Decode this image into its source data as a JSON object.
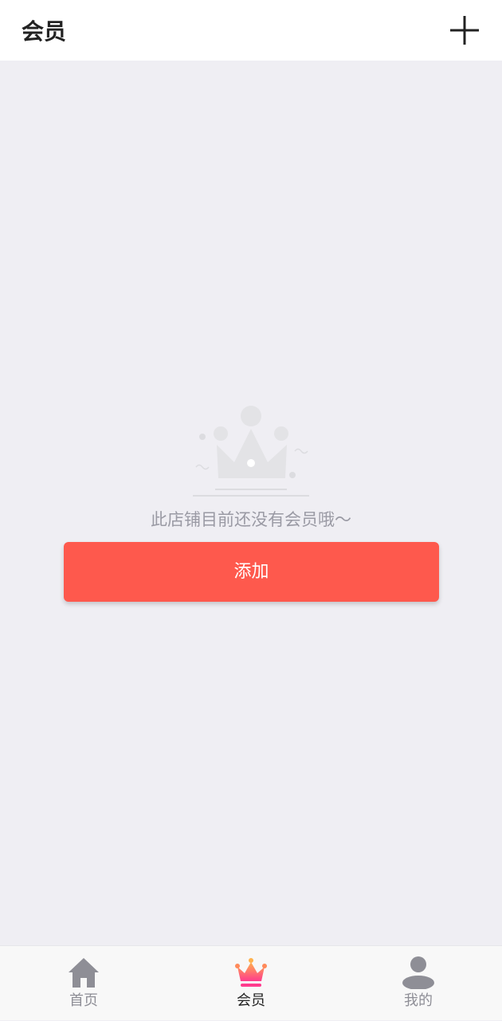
{
  "header": {
    "title": "会员",
    "add_icon": "plus-icon"
  },
  "empty_state": {
    "illustration": "crown-illustration",
    "message": "此店铺目前还没有会员哦～",
    "add_button_label": "添加"
  },
  "tabbar": {
    "active_tab": "会员",
    "items": [
      {
        "label": "首页",
        "icon": "home-icon"
      },
      {
        "label": "会员",
        "icon": "crown-icon"
      },
      {
        "label": "我的",
        "icon": "person-icon"
      }
    ]
  },
  "colors": {
    "accent": "#fe594d",
    "background": "#efeef3",
    "tab_inactive": "#8e8e96",
    "crown_gradient_top": "#ffb24d",
    "crown_gradient_bottom": "#ff3b8d"
  }
}
